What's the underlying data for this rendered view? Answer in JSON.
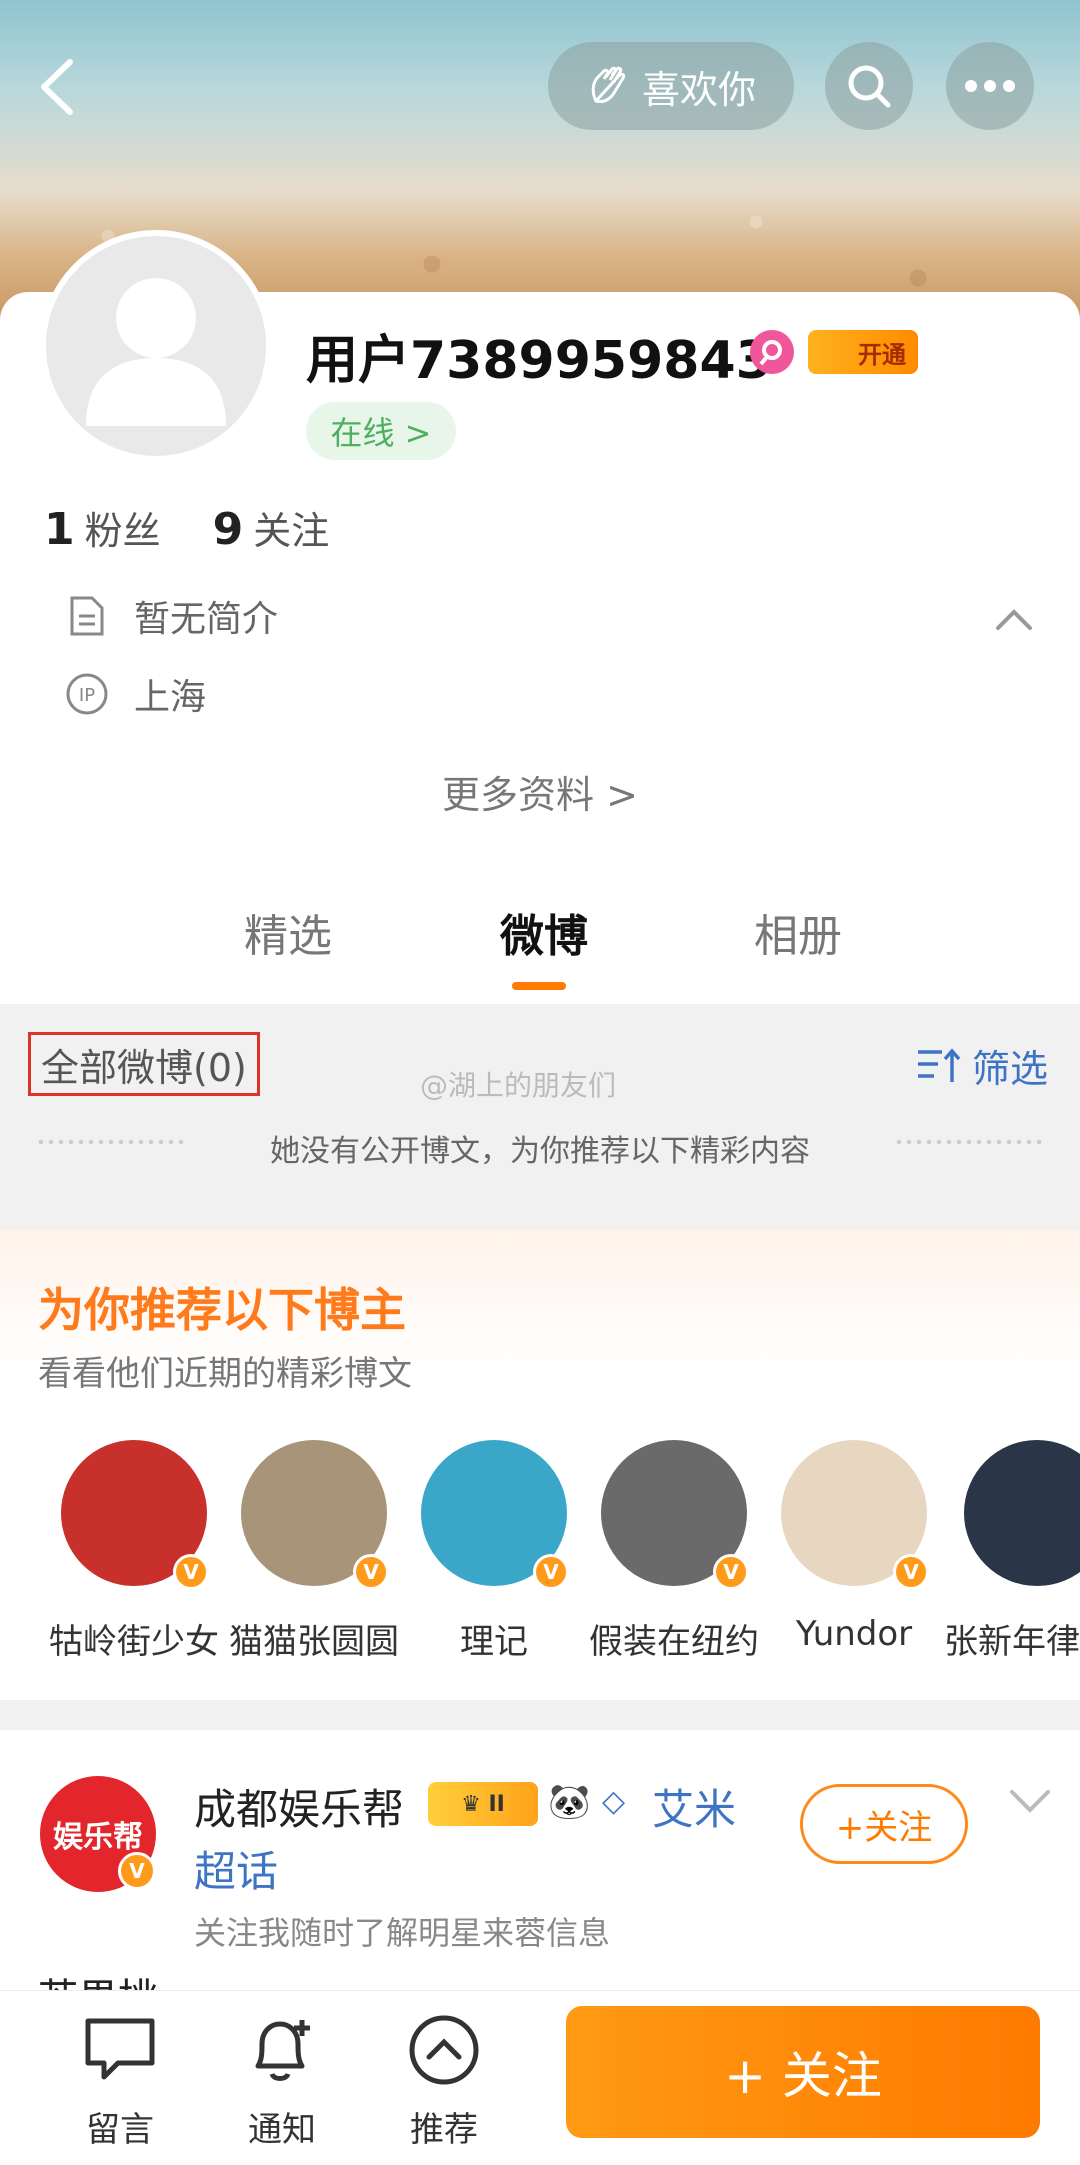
{
  "header": {
    "like_label": "喜欢你",
    "back_icon": "chevron-left-icon",
    "search_icon": "search-icon",
    "more_icon": "more-dots-icon"
  },
  "profile": {
    "username": "用户7389959843",
    "vip_label": "开通",
    "online_label": "在线 >",
    "followers_count": "1",
    "followers_label": "粉丝",
    "following_count": "9",
    "following_label": "关注",
    "bio": "暂无简介",
    "ip_location": "上海",
    "more_info": "更多资料 >"
  },
  "tabs": [
    {
      "label": "精选",
      "active": false
    },
    {
      "label": "微博",
      "active": true
    },
    {
      "label": "相册",
      "active": false
    }
  ],
  "feed": {
    "all_posts": "全部微博(0)",
    "filter": "筛选",
    "watermark": "@湖上的朋友们",
    "no_posts": "她没有公开博文，为你推荐以下精彩内容"
  },
  "recommend": {
    "title": "为你推荐以下博主",
    "subtitle": "看看他们近期的精彩博文",
    "bloggers": [
      {
        "name": "牯岭街少女",
        "color": "#c8302c"
      },
      {
        "name": "猫猫张圆圆",
        "color": "#a89478"
      },
      {
        "name": "理记",
        "color": "#3aa7c9"
      },
      {
        "name": "假装在纽约",
        "color": "#6a6a6a"
      },
      {
        "name": "Yundor",
        "color": "#e8d7c0"
      },
      {
        "name": "张新年律",
        "color": "#2a3547"
      }
    ]
  },
  "post": {
    "avatar_text": "娱乐帮",
    "name": "成都娱乐帮",
    "level": "II",
    "topic_1": "艾米",
    "topic_2": "超话",
    "desc": "关注我随时了解明星来蓉信息",
    "follow_label": "+关注",
    "text": "芒果桃"
  },
  "bottom_bar": {
    "comment_label": "留言",
    "notify_label": "通知",
    "recommend_label": "推荐",
    "follow_label": "+ 关注"
  },
  "colors": {
    "accent": "#ff7a00",
    "link": "#3d74c4",
    "online": "#4caf62"
  }
}
